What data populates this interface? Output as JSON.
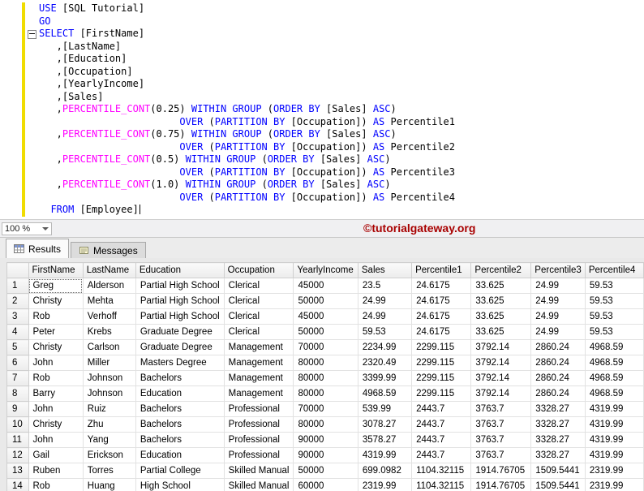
{
  "colors": {
    "keyword": "#0000FF",
    "system_function": "#FF00FF",
    "plain_text": "#000000",
    "watermark": "#A80000",
    "change_bar": "#F0DC00"
  },
  "editor": {
    "lines": [
      {
        "tokens": [
          [
            "k",
            "USE"
          ],
          [
            "p",
            " [SQL Tutorial]"
          ]
        ]
      },
      {
        "tokens": [
          [
            "k",
            "GO"
          ]
        ]
      },
      {
        "tokens": [
          [
            "k",
            "SELECT"
          ],
          [
            "p",
            " [FirstName]"
          ]
        ]
      },
      {
        "tokens": [
          [
            "p",
            "   ,[LastName]"
          ]
        ]
      },
      {
        "tokens": [
          [
            "p",
            "   ,[Education]"
          ]
        ]
      },
      {
        "tokens": [
          [
            "p",
            "   ,[Occupation]"
          ]
        ]
      },
      {
        "tokens": [
          [
            "p",
            "   ,[YearlyIncome]"
          ]
        ]
      },
      {
        "tokens": [
          [
            "p",
            "   ,[Sales]"
          ]
        ]
      },
      {
        "tokens": [
          [
            "p",
            "   ,"
          ],
          [
            "f",
            "PERCENTILE_CONT"
          ],
          [
            "p",
            "(0.25) "
          ],
          [
            "k",
            "WITHIN GROUP"
          ],
          [
            "p",
            " ("
          ],
          [
            "k",
            "ORDER BY"
          ],
          [
            "p",
            " [Sales] "
          ],
          [
            "k",
            "ASC"
          ],
          [
            "p",
            ")"
          ]
        ]
      },
      {
        "tokens": [
          [
            "p",
            "                        "
          ],
          [
            "k",
            "OVER"
          ],
          [
            "p",
            " ("
          ],
          [
            "k",
            "PARTITION BY"
          ],
          [
            "p",
            " [Occupation]) "
          ],
          [
            "k",
            "AS"
          ],
          [
            "p",
            " Percentile1"
          ]
        ]
      },
      {
        "tokens": [
          [
            "p",
            "   ,"
          ],
          [
            "f",
            "PERCENTILE_CONT"
          ],
          [
            "p",
            "(0.75) "
          ],
          [
            "k",
            "WITHIN GROUP"
          ],
          [
            "p",
            " ("
          ],
          [
            "k",
            "ORDER BY"
          ],
          [
            "p",
            " [Sales] "
          ],
          [
            "k",
            "ASC"
          ],
          [
            "p",
            ")"
          ]
        ]
      },
      {
        "tokens": [
          [
            "p",
            "                        "
          ],
          [
            "k",
            "OVER"
          ],
          [
            "p",
            " ("
          ],
          [
            "k",
            "PARTITION BY"
          ],
          [
            "p",
            " [Occupation]) "
          ],
          [
            "k",
            "AS"
          ],
          [
            "p",
            " Percentile2"
          ]
        ]
      },
      {
        "tokens": [
          [
            "p",
            "   ,"
          ],
          [
            "f",
            "PERCENTILE_CONT"
          ],
          [
            "p",
            "(0.5) "
          ],
          [
            "k",
            "WITHIN GROUP"
          ],
          [
            "p",
            " ("
          ],
          [
            "k",
            "ORDER BY"
          ],
          [
            "p",
            " [Sales] "
          ],
          [
            "k",
            "ASC"
          ],
          [
            "p",
            ")"
          ]
        ]
      },
      {
        "tokens": [
          [
            "p",
            "                        "
          ],
          [
            "k",
            "OVER"
          ],
          [
            "p",
            " ("
          ],
          [
            "k",
            "PARTITION BY"
          ],
          [
            "p",
            " [Occupation]) "
          ],
          [
            "k",
            "AS"
          ],
          [
            "p",
            " Percentile3"
          ]
        ]
      },
      {
        "tokens": [
          [
            "p",
            "   ,"
          ],
          [
            "f",
            "PERCENTILE_CONT"
          ],
          [
            "p",
            "(1.0) "
          ],
          [
            "k",
            "WITHIN GROUP"
          ],
          [
            "p",
            " ("
          ],
          [
            "k",
            "ORDER BY"
          ],
          [
            "p",
            " [Sales] "
          ],
          [
            "k",
            "ASC"
          ],
          [
            "p",
            ")"
          ]
        ]
      },
      {
        "tokens": [
          [
            "p",
            "                        "
          ],
          [
            "k",
            "OVER"
          ],
          [
            "p",
            " ("
          ],
          [
            "k",
            "PARTITION BY"
          ],
          [
            "p",
            " [Occupation]) "
          ],
          [
            "k",
            "AS"
          ],
          [
            "p",
            " Percentile4"
          ]
        ]
      },
      {
        "tokens": [
          [
            "p",
            "  "
          ],
          [
            "k",
            "FROM"
          ],
          [
            "p",
            " [Employee]"
          ]
        ],
        "caret": true
      }
    ]
  },
  "status": {
    "zoom_value": "100 %",
    "watermark": "©tutorialgateway.org"
  },
  "tabs": [
    {
      "label": "Results"
    },
    {
      "label": "Messages"
    }
  ],
  "grid": {
    "columns": [
      "FirstName",
      "LastName",
      "Education",
      "Occupation",
      "YearlyIncome",
      "Sales",
      "Percentile1",
      "Percentile2",
      "Percentile3",
      "Percentile4"
    ],
    "rows": [
      [
        "Greg",
        "Alderson",
        "Partial High School",
        "Clerical",
        "45000",
        "23.5",
        "24.6175",
        "33.625",
        "24.99",
        "59.53"
      ],
      [
        "Christy",
        "Mehta",
        "Partial High School",
        "Clerical",
        "50000",
        "24.99",
        "24.6175",
        "33.625",
        "24.99",
        "59.53"
      ],
      [
        "Rob",
        "Verhoff",
        "Partial High School",
        "Clerical",
        "45000",
        "24.99",
        "24.6175",
        "33.625",
        "24.99",
        "59.53"
      ],
      [
        "Peter",
        "Krebs",
        "Graduate Degree",
        "Clerical",
        "50000",
        "59.53",
        "24.6175",
        "33.625",
        "24.99",
        "59.53"
      ],
      [
        "Christy",
        "Carlson",
        "Graduate Degree",
        "Management",
        "70000",
        "2234.99",
        "2299.115",
        "3792.14",
        "2860.24",
        "4968.59"
      ],
      [
        "John",
        "Miller",
        "Masters Degree",
        "Management",
        "80000",
        "2320.49",
        "2299.115",
        "3792.14",
        "2860.24",
        "4968.59"
      ],
      [
        "Rob",
        "Johnson",
        "Bachelors",
        "Management",
        "80000",
        "3399.99",
        "2299.115",
        "3792.14",
        "2860.24",
        "4968.59"
      ],
      [
        "Barry",
        "Johnson",
        "Education",
        "Management",
        "80000",
        "4968.59",
        "2299.115",
        "3792.14",
        "2860.24",
        "4968.59"
      ],
      [
        "John",
        "Ruiz",
        "Bachelors",
        "Professional",
        "70000",
        "539.99",
        "2443.7",
        "3763.7",
        "3328.27",
        "4319.99"
      ],
      [
        "Christy",
        "Zhu",
        "Bachelors",
        "Professional",
        "80000",
        "3078.27",
        "2443.7",
        "3763.7",
        "3328.27",
        "4319.99"
      ],
      [
        "John",
        "Yang",
        "Bachelors",
        "Professional",
        "90000",
        "3578.27",
        "2443.7",
        "3763.7",
        "3328.27",
        "4319.99"
      ],
      [
        "Gail",
        "Erickson",
        "Education",
        "Professional",
        "90000",
        "4319.99",
        "2443.7",
        "3763.7",
        "3328.27",
        "4319.99"
      ],
      [
        "Ruben",
        "Torres",
        "Partial College",
        "Skilled Manual",
        "50000",
        "699.0982",
        "1104.32115",
        "1914.76705",
        "1509.5441",
        "2319.99"
      ],
      [
        "Rob",
        "Huang",
        "High School",
        "Skilled Manual",
        "60000",
        "2319.99",
        "1104.32115",
        "1914.76705",
        "1509.5441",
        "2319.99"
      ]
    ],
    "selected_cell": {
      "row": 0,
      "col": 0
    }
  }
}
